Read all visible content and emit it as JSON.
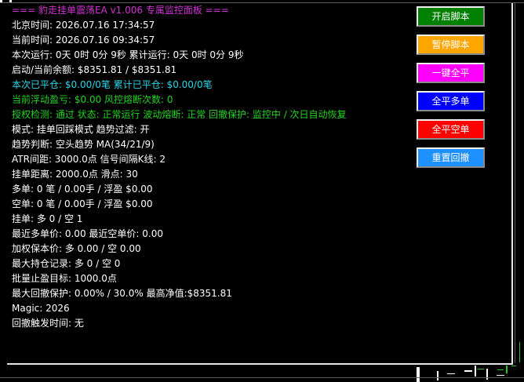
{
  "colors": {
    "background": "#000000",
    "title": "#d433d4",
    "cyan": "#2bd6e6",
    "green": "#22d422",
    "text": "#ffffff"
  },
  "panel": {
    "title": "=== 豹走挂单震荡EA v1.006 专属监控面板 ===",
    "beijing_time": "北京时间: 2026.07.16 17:34:57",
    "current_time": "当前时间: 2026.07.16 09:34:57",
    "run_time": "本次运行: 0天 0时 0分 9秒    累计运行: 0天 0时 0分 9秒",
    "balance": "启动/当前余额: $8351.81 / $8351.81",
    "closed": "本次已平仓: $0.00/0笔    累计已平仓: $0.00/0笔",
    "floating": "当前浮动盈亏: $0.00    风控熔断次数: 0",
    "auth": "授权检测:  通过    状态: 正常运行    波动熔断: 正常    回撤保护: 监控中 / 次日自动恢复",
    "mode": "模式: 挂单回踩模式    趋势过滤: 开",
    "trend": "趋势判断: 空头趋势    MA(34/21/9)",
    "atr": "ATR间距: 3000.0点    信号间隔K线: 2",
    "distance": "挂单距离: 2000.0点    滑点: 30",
    "long": "多单: 0 笔 / 0.00手 / 浮盈 $0.00",
    "short": "空单: 0 笔 / 0.00手 / 浮盈 $0.00",
    "pending": "挂单: 多 0 / 空 1",
    "recent_price": "最近多单价: 0.00    最近空单价: 0.00",
    "weighted": "加权保本价: 多 0.00 / 空 0.00",
    "max_hold": "最大持仓记录: 多 0 / 空 0",
    "batch_tp": "批量止盈目标: 1000.0点",
    "max_dd": "最大回撤保护: 0.00% / 30.0%    最高净值:$8351.81",
    "magic": "Magic: 2026",
    "dd_time": "回撤触发时间: 无"
  },
  "buttons": {
    "start": {
      "label": "开启脚本",
      "color": "#008000"
    },
    "pause": {
      "label": "暂停脚本",
      "color": "#ffa500"
    },
    "close_all": {
      "label": "一键全平",
      "color": "#ff00ff"
    },
    "close_long": {
      "label": "全平多单",
      "color": "#0000ff"
    },
    "close_short": {
      "label": "全平空单",
      "color": "#ff0000"
    },
    "reset_dd": {
      "label": "重置回撤",
      "color": "#1e90ff"
    }
  }
}
